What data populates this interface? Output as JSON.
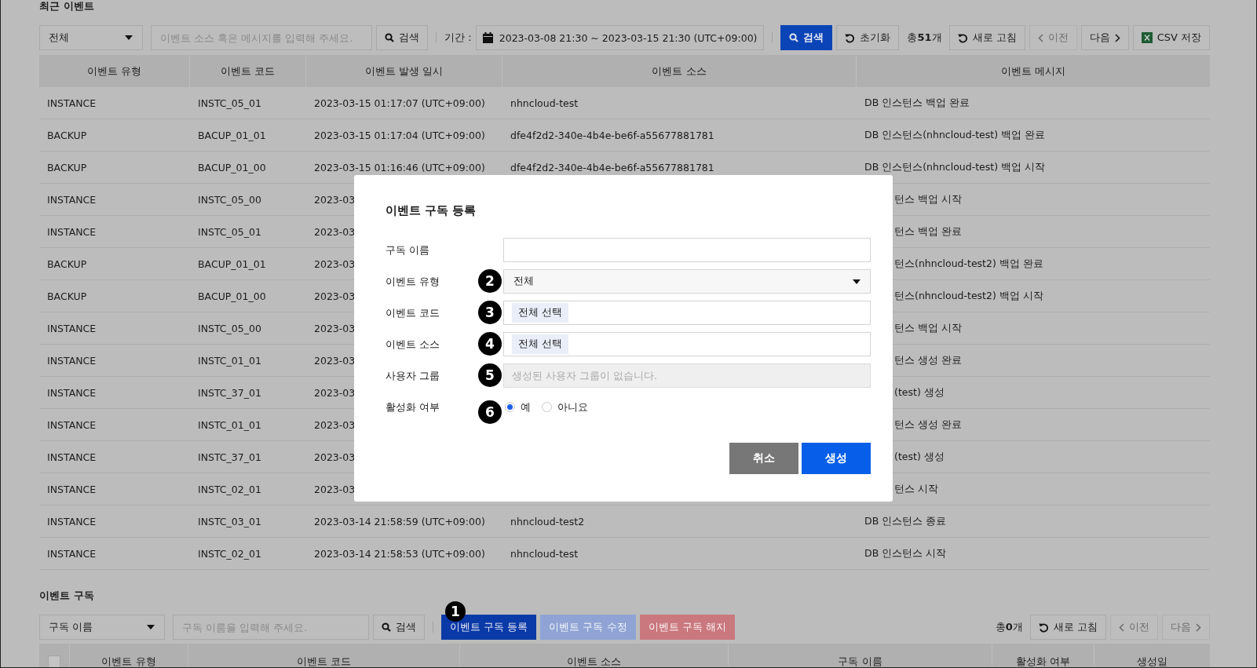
{
  "recent": {
    "title": "최근 이벤트",
    "filter": {
      "value": "전체"
    },
    "search": {
      "placeholder": "이벤트 소스 혹은 메시지를 입력해 주세요.",
      "button": "검색"
    },
    "period": {
      "label": "기간 :",
      "value": "2023-03-08 21:30 ~ 2023-03-15 21:30 (UTC+09:00)"
    },
    "search_button": "검색",
    "reset_button": "초기화",
    "total": "총**51**개",
    "refresh": "새로 고침",
    "prev": {
      "label": "이전",
      "disabled": true
    },
    "next": {
      "label": "다음",
      "disabled": false
    },
    "csv": "CSV 저장",
    "columns": [
      "이벤트 유형",
      "이벤트 코드",
      "이벤트 발생 일시",
      "이벤트 소스",
      "이벤트 메시지"
    ],
    "rows": [
      {
        "type": "INSTANCE",
        "code": "INSTC_05_01",
        "time": "2023-03-15 01:17:07 (UTC+09:00)",
        "source": "nhncloud-test",
        "message": "DB 인스턴스 백업 완료"
      },
      {
        "type": "BACKUP",
        "code": "BACUP_01_01",
        "time": "2023-03-15 01:17:04 (UTC+09:00)",
        "source": "dfe4f2d2-340e-4b4e-be6f-a55677881781",
        "message": "DB 인스턴스(nhncloud-test) 백업 완료"
      },
      {
        "type": "BACKUP",
        "code": "BACUP_01_00",
        "time": "2023-03-15 01:16:46 (UTC+09:00)",
        "source": "dfe4f2d2-340e-4b4e-be6f-a55677881781",
        "message": "DB 인스턴스(nhncloud-test) 백업 시작"
      },
      {
        "type": "INSTANCE",
        "code": "INSTC_05_00",
        "time": "2023-03",
        "message": "턴스 백업 시작"
      },
      {
        "type": "INSTANCE",
        "code": "INSTC_05_01",
        "time": "2023-03",
        "message": "턴스 백업 완료"
      },
      {
        "type": "BACKUP",
        "code": "BACUP_01_01",
        "time": "2023-03",
        "message": "턴스(nhncloud-test2) 백업 완료"
      },
      {
        "type": "BACKUP",
        "code": "BACUP_01_00",
        "time": "2023-03",
        "message": "턴스(nhncloud-test2) 백업 시작"
      },
      {
        "type": "INSTANCE",
        "code": "INSTC_05_00",
        "time": "2023-03",
        "message": "턴스 백업 시작"
      },
      {
        "type": "INSTANCE",
        "code": "INSTC_01_01",
        "time": "2023-03",
        "message": "턴스 생성 완료"
      },
      {
        "type": "INSTANCE",
        "code": "INSTC_37_01",
        "time": "2023-03",
        "message": "(test) 생성"
      },
      {
        "type": "INSTANCE",
        "code": "INSTC_01_01",
        "time": "2023-03",
        "message": "턴스 생성 완료"
      },
      {
        "type": "INSTANCE",
        "code": "INSTC_37_01",
        "time": "2023-03",
        "message": "(test) 생성"
      },
      {
        "type": "INSTANCE",
        "code": "INSTC_02_01",
        "time": "2023-03",
        "message": "턴스 시작"
      },
      {
        "type": "INSTANCE",
        "code": "INSTC_03_01",
        "time": "2023-03-14 21:58:59 (UTC+09:00)",
        "source": "nhncloud-test2",
        "message": "DB 인스턴스 종료"
      },
      {
        "type": "INSTANCE",
        "code": "INSTC_02_01",
        "time": "2023-03-14 21:58:53 (UTC+09:00)",
        "source": "nhncloud-test",
        "message": "DB 인스턴스 시작"
      }
    ]
  },
  "subscriptions": {
    "title": "이벤트 구독",
    "filter": {
      "value": "구독 이름"
    },
    "search": {
      "placeholder": "구독 이름을 입력해 주세요.",
      "button": "검색"
    },
    "actions": [
      {
        "label": "이벤트 구독 등록",
        "kind": "primary",
        "disabled": false,
        "marker": "1"
      },
      {
        "label": "이벤트 구독 수정",
        "kind": "primary",
        "disabled": true
      },
      {
        "label": "이벤트 구독 해지",
        "kind": "danger",
        "disabled": true
      }
    ],
    "total": "총**0**개",
    "refresh": "새로 고침",
    "prev": {
      "label": "이전",
      "disabled": true
    },
    "next": {
      "label": "다음",
      "disabled": true
    },
    "select_all": {
      "checked": false
    },
    "columns": [
      "이벤트 유형",
      "이벤트 코드",
      "이벤트 소스",
      "구독 이름",
      "활성화 여부",
      "생성일"
    ]
  },
  "dialog": {
    "title": "이벤트 구독 등록",
    "fields": [
      {
        "label": "구독 이름",
        "kind": "text"
      },
      {
        "label": "이벤트 유형",
        "kind": "select",
        "value": "전체",
        "marker": "2"
      },
      {
        "label": "이벤트 코드",
        "kind": "chips",
        "chip": "전체 선택",
        "marker": "3"
      },
      {
        "label": "이벤트 소스",
        "kind": "chips",
        "chip": "전체 선택",
        "marker": "4"
      },
      {
        "label": "사용자 그룹",
        "kind": "text",
        "placeholder": "생성된 사용자 그룹이 없습니다.",
        "disabled": true,
        "marker": "5"
      },
      {
        "label": "활성화 여부",
        "kind": "radio",
        "marker": "6",
        "options": [
          {
            "label": "예",
            "selected": true
          },
          {
            "label": "아니요",
            "selected": false
          }
        ]
      }
    ],
    "buttons": [
      {
        "label": "취소",
        "kind": "secondary"
      },
      {
        "label": "생성",
        "kind": "primary"
      }
    ]
  }
}
